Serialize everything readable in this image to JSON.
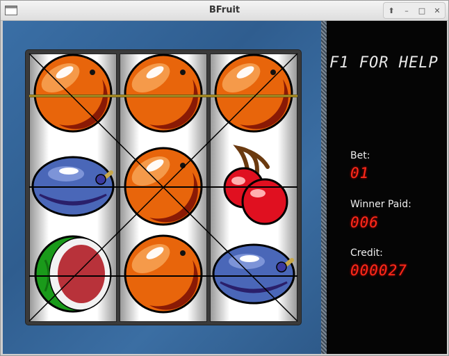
{
  "window": {
    "title": "BFruit"
  },
  "title_buttons": [
    {
      "icon": "arrow-up-icon",
      "glyph": "⬆"
    },
    {
      "icon": "minimize-icon",
      "glyph": "–"
    },
    {
      "icon": "maximize-icon",
      "glyph": "□"
    },
    {
      "icon": "close-icon",
      "glyph": "✕"
    }
  ],
  "help": {
    "text": "F1 FOR HELP"
  },
  "bet": {
    "label": "Bet:",
    "value": "01"
  },
  "winner_paid": {
    "label": "Winner Paid:",
    "value": "006"
  },
  "credit": {
    "label": "Credit:",
    "value": "000027"
  },
  "reels": [
    [
      "orange",
      "plum",
      "watermelon"
    ],
    [
      "orange",
      "orange",
      "orange"
    ],
    [
      "orange",
      "cherry",
      "plum"
    ]
  ],
  "colors": {
    "background_blue": "#3a6fa6",
    "led_red": "#ff2a1a",
    "orange": "#e8650b",
    "plum": "#4a67b8",
    "cherry": "#e01020",
    "melon_green": "#1a9a1a"
  }
}
